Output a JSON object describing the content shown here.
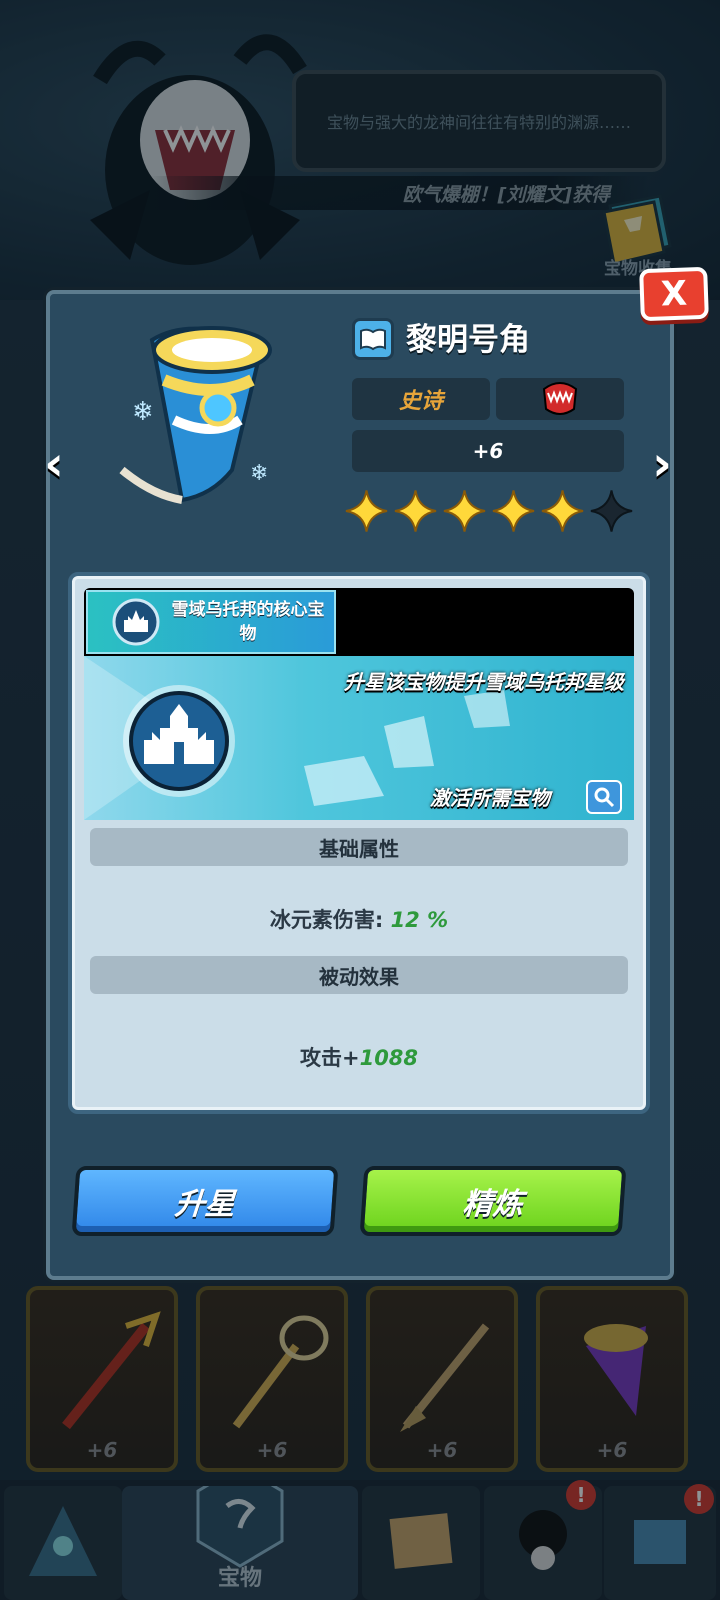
{
  "background": {
    "speech_text": "宝物与强大的龙神间往往有特别的渊源……",
    "banner_text": "欧气爆棚！[刘耀文]获得",
    "collection_label": "宝物收集",
    "bg_cards": [
      {
        "level": "+6"
      },
      {
        "level": "+6"
      },
      {
        "level": "+6"
      },
      {
        "level": "+6"
      }
    ]
  },
  "nav": {
    "active_label": "宝物",
    "alerts": [
      "!",
      "!"
    ]
  },
  "modal": {
    "close_label": "X",
    "prev_label": "‹",
    "next_label": "›",
    "item": {
      "name": "黎明号角",
      "rarity": "史诗",
      "plus_level": "+6",
      "stars_filled": 5,
      "stars_total": 6
    },
    "core": {
      "tag": "雪域乌托邦的核心宝物",
      "description": "升星该宝物提升雪域乌托邦星级",
      "requirement": "激活所需宝物"
    },
    "base_attr": {
      "title": "基础属性",
      "label": "冰元素伤害:",
      "value": "12 %"
    },
    "passive": {
      "title": "被动效果",
      "label": "攻击+",
      "value": "1088"
    },
    "buttons": {
      "upgrade": "升星",
      "refine": "精炼"
    }
  },
  "colors": {
    "rarity": "#e7a53a",
    "upgrade": "#2f86e8",
    "refine": "#6bd21c",
    "close": "#e8402f",
    "value_green": "#2e9a3c"
  }
}
